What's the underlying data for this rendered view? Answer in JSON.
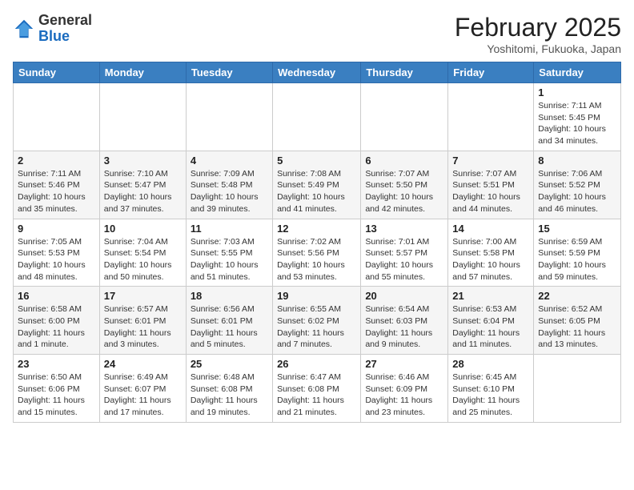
{
  "header": {
    "logo_line1": "General",
    "logo_line2": "Blue",
    "month_title": "February 2025",
    "location": "Yoshitomi, Fukuoka, Japan"
  },
  "weekdays": [
    "Sunday",
    "Monday",
    "Tuesday",
    "Wednesday",
    "Thursday",
    "Friday",
    "Saturday"
  ],
  "weeks": [
    [
      {
        "day": "",
        "info": ""
      },
      {
        "day": "",
        "info": ""
      },
      {
        "day": "",
        "info": ""
      },
      {
        "day": "",
        "info": ""
      },
      {
        "day": "",
        "info": ""
      },
      {
        "day": "",
        "info": ""
      },
      {
        "day": "1",
        "info": "Sunrise: 7:11 AM\nSunset: 5:45 PM\nDaylight: 10 hours\nand 34 minutes."
      }
    ],
    [
      {
        "day": "2",
        "info": "Sunrise: 7:11 AM\nSunset: 5:46 PM\nDaylight: 10 hours\nand 35 minutes."
      },
      {
        "day": "3",
        "info": "Sunrise: 7:10 AM\nSunset: 5:47 PM\nDaylight: 10 hours\nand 37 minutes."
      },
      {
        "day": "4",
        "info": "Sunrise: 7:09 AM\nSunset: 5:48 PM\nDaylight: 10 hours\nand 39 minutes."
      },
      {
        "day": "5",
        "info": "Sunrise: 7:08 AM\nSunset: 5:49 PM\nDaylight: 10 hours\nand 41 minutes."
      },
      {
        "day": "6",
        "info": "Sunrise: 7:07 AM\nSunset: 5:50 PM\nDaylight: 10 hours\nand 42 minutes."
      },
      {
        "day": "7",
        "info": "Sunrise: 7:07 AM\nSunset: 5:51 PM\nDaylight: 10 hours\nand 44 minutes."
      },
      {
        "day": "8",
        "info": "Sunrise: 7:06 AM\nSunset: 5:52 PM\nDaylight: 10 hours\nand 46 minutes."
      }
    ],
    [
      {
        "day": "9",
        "info": "Sunrise: 7:05 AM\nSunset: 5:53 PM\nDaylight: 10 hours\nand 48 minutes."
      },
      {
        "day": "10",
        "info": "Sunrise: 7:04 AM\nSunset: 5:54 PM\nDaylight: 10 hours\nand 50 minutes."
      },
      {
        "day": "11",
        "info": "Sunrise: 7:03 AM\nSunset: 5:55 PM\nDaylight: 10 hours\nand 51 minutes."
      },
      {
        "day": "12",
        "info": "Sunrise: 7:02 AM\nSunset: 5:56 PM\nDaylight: 10 hours\nand 53 minutes."
      },
      {
        "day": "13",
        "info": "Sunrise: 7:01 AM\nSunset: 5:57 PM\nDaylight: 10 hours\nand 55 minutes."
      },
      {
        "day": "14",
        "info": "Sunrise: 7:00 AM\nSunset: 5:58 PM\nDaylight: 10 hours\nand 57 minutes."
      },
      {
        "day": "15",
        "info": "Sunrise: 6:59 AM\nSunset: 5:59 PM\nDaylight: 10 hours\nand 59 minutes."
      }
    ],
    [
      {
        "day": "16",
        "info": "Sunrise: 6:58 AM\nSunset: 6:00 PM\nDaylight: 11 hours\nand 1 minute."
      },
      {
        "day": "17",
        "info": "Sunrise: 6:57 AM\nSunset: 6:01 PM\nDaylight: 11 hours\nand 3 minutes."
      },
      {
        "day": "18",
        "info": "Sunrise: 6:56 AM\nSunset: 6:01 PM\nDaylight: 11 hours\nand 5 minutes."
      },
      {
        "day": "19",
        "info": "Sunrise: 6:55 AM\nSunset: 6:02 PM\nDaylight: 11 hours\nand 7 minutes."
      },
      {
        "day": "20",
        "info": "Sunrise: 6:54 AM\nSunset: 6:03 PM\nDaylight: 11 hours\nand 9 minutes."
      },
      {
        "day": "21",
        "info": "Sunrise: 6:53 AM\nSunset: 6:04 PM\nDaylight: 11 hours\nand 11 minutes."
      },
      {
        "day": "22",
        "info": "Sunrise: 6:52 AM\nSunset: 6:05 PM\nDaylight: 11 hours\nand 13 minutes."
      }
    ],
    [
      {
        "day": "23",
        "info": "Sunrise: 6:50 AM\nSunset: 6:06 PM\nDaylight: 11 hours\nand 15 minutes."
      },
      {
        "day": "24",
        "info": "Sunrise: 6:49 AM\nSunset: 6:07 PM\nDaylight: 11 hours\nand 17 minutes."
      },
      {
        "day": "25",
        "info": "Sunrise: 6:48 AM\nSunset: 6:08 PM\nDaylight: 11 hours\nand 19 minutes."
      },
      {
        "day": "26",
        "info": "Sunrise: 6:47 AM\nSunset: 6:08 PM\nDaylight: 11 hours\nand 21 minutes."
      },
      {
        "day": "27",
        "info": "Sunrise: 6:46 AM\nSunset: 6:09 PM\nDaylight: 11 hours\nand 23 minutes."
      },
      {
        "day": "28",
        "info": "Sunrise: 6:45 AM\nSunset: 6:10 PM\nDaylight: 11 hours\nand 25 minutes."
      },
      {
        "day": "",
        "info": ""
      }
    ]
  ]
}
